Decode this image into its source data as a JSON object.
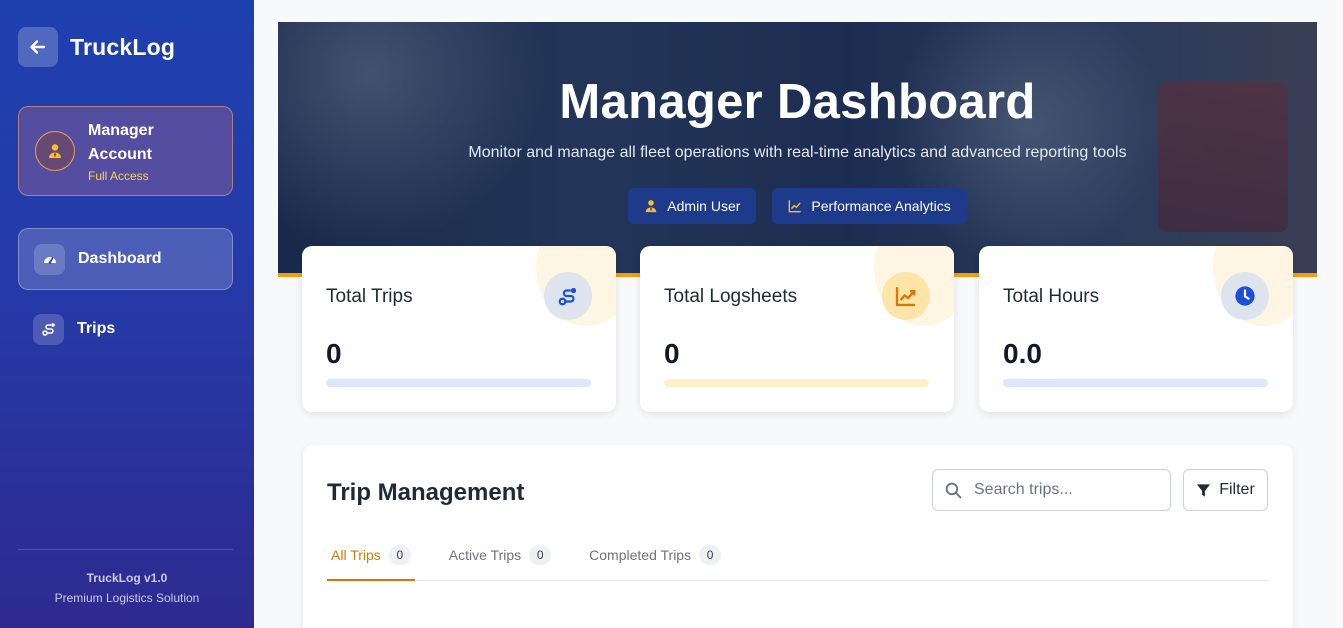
{
  "sidebar": {
    "brand": "TruckLog",
    "account": {
      "name": "Manager Account",
      "role": "Full Access"
    },
    "items": [
      {
        "label": "Dashboard",
        "active": true
      },
      {
        "label": "Trips",
        "active": false
      }
    ],
    "footer": {
      "version": "TruckLog v1.0",
      "tagline": "Premium Logistics Solution"
    }
  },
  "hero": {
    "title": "Manager Dashboard",
    "subtitle": "Monitor and manage all fleet operations with real-time analytics and advanced reporting tools",
    "buttons": [
      "Admin User",
      "Performance Analytics"
    ]
  },
  "stats": [
    {
      "label": "Total Trips",
      "value": "0",
      "icon": "route-icon",
      "icon_color": "#1d4ed8"
    },
    {
      "label": "Total Logsheets",
      "value": "0",
      "icon": "chart-line-icon",
      "icon_color": "#d97706"
    },
    {
      "label": "Total Hours",
      "value": "0.0",
      "icon": "clock-icon",
      "icon_color": "#1d4ed8"
    }
  ],
  "trips": {
    "title": "Trip Management",
    "search_placeholder": "Search trips...",
    "filter_label": "Filter",
    "tabs": [
      {
        "label": "All Trips",
        "count": "0",
        "active": true
      },
      {
        "label": "Active Trips",
        "count": "0",
        "active": false
      },
      {
        "label": "Completed Trips",
        "count": "0",
        "active": false
      }
    ]
  },
  "colors": {
    "sidebar": "#1e40af",
    "accent": "#f59e0b",
    "primary_button": "#1e3a8a"
  }
}
